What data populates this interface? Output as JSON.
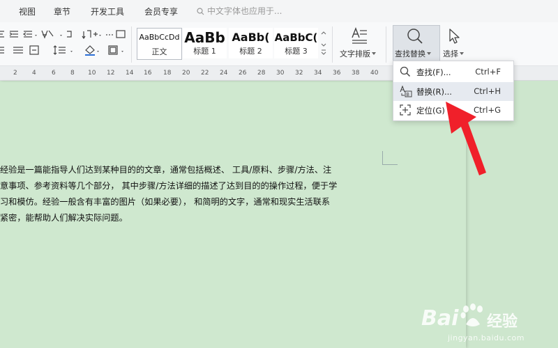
{
  "menu": {
    "items": [
      "视图",
      "章节",
      "开发工具",
      "会员专享"
    ],
    "search_placeholder": "中文字体也应用于..."
  },
  "ribbon": {
    "styles": [
      {
        "sample": "AaBbCcDd",
        "name": "正文"
      },
      {
        "sample": "AaBb",
        "name": "标题 1"
      },
      {
        "sample": "AaBb(",
        "name": "标题 2"
      },
      {
        "sample": "AaBbC(",
        "name": "标题 3"
      }
    ],
    "text_layout_label": "文字排版",
    "find_replace_label": "查找替换",
    "select_label": "选择"
  },
  "ruler": {
    "ticks": [
      "2",
      "4",
      "6",
      "8",
      "10",
      "12",
      "14",
      "16",
      "18",
      "20",
      "22",
      "24",
      "26",
      "28",
      "30",
      "32",
      "34",
      "36",
      "38",
      "40"
    ]
  },
  "dropdown": {
    "items": [
      {
        "label": "查找(F)...",
        "shortcut": "Ctrl+F",
        "icon": "search-icon"
      },
      {
        "label": "替换(R)...",
        "shortcut": "Ctrl+H",
        "icon": "replace-icon"
      },
      {
        "label": "定位(G)",
        "shortcut": "Ctrl+G",
        "icon": "goto-icon"
      }
    ]
  },
  "document": {
    "lines": [
      "经验是一篇能指导人们达到某种目的的文章，通常包括概述、 工具/原料、步骤/方法、注",
      "意事项、参考资料等几个部分， 其中步骤/方法详细的描述了达到目的的操作过程，便于学",
      "习和模仿。经验一般含有丰富的图片（如果必要）， 和简明的文字，通常和现实生活联系",
      "紧密，能帮助人们解决实际问题。"
    ]
  },
  "watermark": {
    "brand": "Bai",
    "brand_tail": "经验",
    "url": "jingyan.baidu.com"
  },
  "colors": {
    "page_bg": "#cfe8cf",
    "arrow": "#f0202a",
    "accent": "#2b6fd6"
  }
}
